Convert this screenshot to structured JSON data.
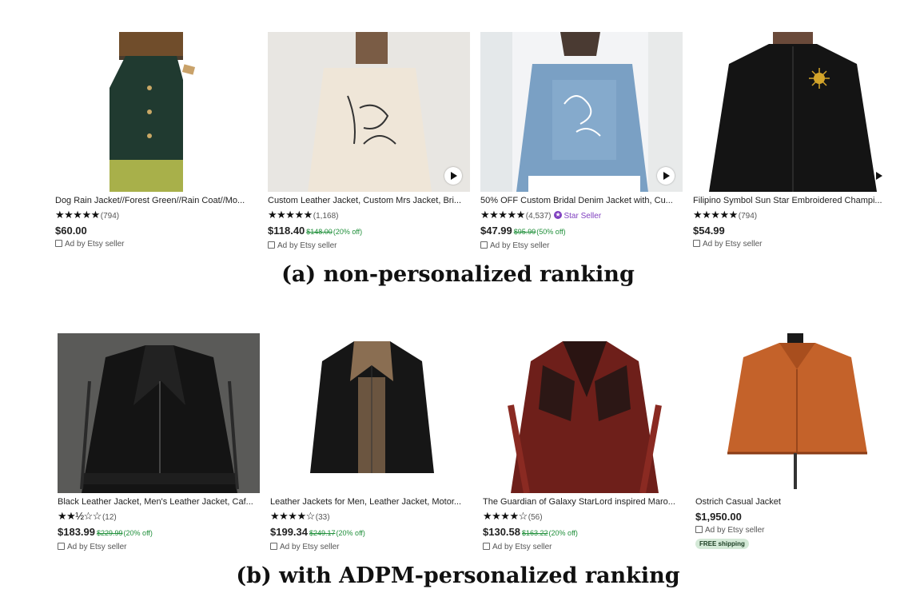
{
  "caption_a": "(a) non-personalized ranking",
  "caption_b": "(b) with ADPM-personalized ranking",
  "row_a": [
    {
      "title": "Dog Rain Jacket//Forest Green//Rain Coat//Mo...",
      "stars": "★★★★★",
      "reviews": "(794)",
      "price": "$60.00",
      "original_price": "",
      "discount": "",
      "star_seller": "",
      "ad": "Ad by Etsy seller",
      "video": false
    },
    {
      "title": "Custom Leather Jacket, Custom Mrs Jacket, Bri...",
      "stars": "★★★★★",
      "reviews": "(1,168)",
      "price": "$118.40",
      "original_price": "$148.00",
      "discount": "(20% off)",
      "star_seller": "",
      "ad": "Ad by Etsy seller",
      "video": true
    },
    {
      "title": "50% OFF Custom Bridal Denim Jacket with, Cu...",
      "stars": "★★★★★",
      "reviews": "(4,537)",
      "price": "$47.99",
      "original_price": "$95.99",
      "discount": "(50% off)",
      "star_seller": "Star Seller",
      "ad": "Ad by Etsy seller",
      "video": true
    },
    {
      "title": "Filipino Symbol Sun Star Embroidered Champi...",
      "stars": "★★★★★",
      "reviews": "(794)",
      "price": "$54.99",
      "original_price": "",
      "discount": "",
      "star_seller": "",
      "ad": "Ad by Etsy seller",
      "video": true
    }
  ],
  "row_b": [
    {
      "title": "Black Leather Jacket, Men's Leather Jacket, Caf...",
      "stars": "★★½☆☆",
      "reviews": "(12)",
      "price": "$183.99",
      "original_price": "$229.99",
      "discount": "(20% off)",
      "ad": "Ad by Etsy seller",
      "free_shipping": ""
    },
    {
      "title": "Leather Jackets for Men, Leather Jacket, Motor...",
      "stars": "★★★★☆",
      "reviews": "(33)",
      "price": "$199.34",
      "original_price": "$249.17",
      "discount": "(20% off)",
      "ad": "Ad by Etsy seller",
      "free_shipping": ""
    },
    {
      "title": "The Guardian of Galaxy StarLord inspired Maro...",
      "stars": "★★★★☆",
      "reviews": "(56)",
      "price": "$130.58",
      "original_price": "$163.22",
      "discount": "(20% off)",
      "ad": "Ad by Etsy seller",
      "free_shipping": ""
    },
    {
      "title": "Ostrich Casual Jacket",
      "stars": "",
      "reviews": "",
      "price": "$1,950.00",
      "original_price": "",
      "discount": "",
      "ad": "Ad by Etsy seller",
      "free_shipping": "FREE shipping"
    }
  ],
  "colors": {
    "sale_green": "#1f8f3a",
    "star_seller_purple": "#7f3fbf",
    "free_shipping_bg": "#d4e9d7"
  }
}
